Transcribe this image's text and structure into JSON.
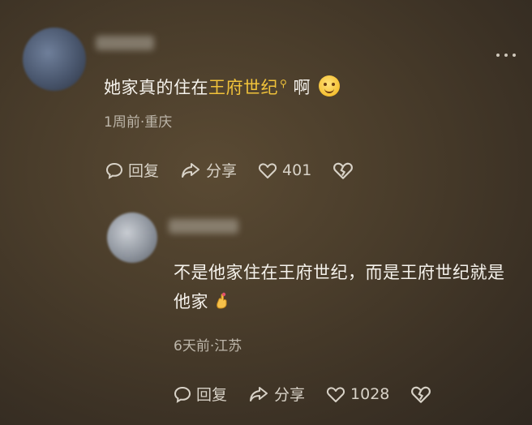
{
  "main_comment": {
    "text_prefix": "她家真的住在",
    "link_text": "王府世纪",
    "text_suffix": "啊",
    "meta": "1周前·重庆",
    "actions": {
      "reply_label": "回复",
      "share_label": "分享",
      "like_count": "401"
    }
  },
  "reply_comment": {
    "text": "不是他家住在王府世纪，而是王府世纪就是他家",
    "meta": "6天前·江苏",
    "actions": {
      "reply_label": "回复",
      "share_label": "分享",
      "like_count": "1028"
    }
  },
  "icons": {
    "more": "more-icon",
    "reply": "comment-bubble-icon",
    "share": "share-arrow-icon",
    "like": "heart-icon",
    "dislike": "broken-heart-icon",
    "emoji_main": "smiling-face-emoji",
    "emoji_reply": "crossed-fingers-emoji",
    "link_search": "search-icon"
  },
  "colors": {
    "link": "#f0c23a",
    "text": "#f5f2ec",
    "meta": "#bdb6aa",
    "action": "#d8d2c7"
  }
}
